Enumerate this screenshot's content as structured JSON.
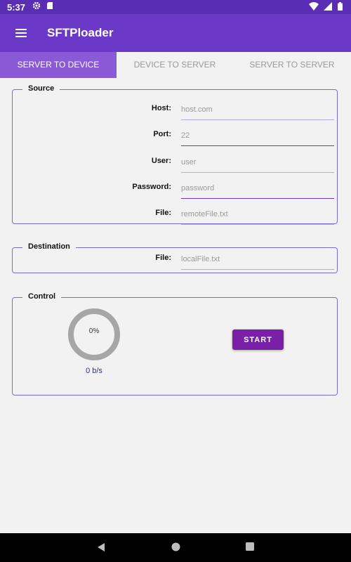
{
  "status_bar": {
    "time": "5:37",
    "left_icons": [
      "gear-icon",
      "sd-card-icon"
    ],
    "right_icons": [
      "wifi-icon",
      "signal-icon",
      "battery-icon"
    ]
  },
  "toolbar": {
    "title": "SFTPloader",
    "color": "#6a39c7"
  },
  "tabs": [
    {
      "label": "SERVER TO DEVICE",
      "active": true
    },
    {
      "label": "DEVICE TO SERVER",
      "active": false
    },
    {
      "label": "SERVER TO SERVER",
      "active": false
    }
  ],
  "source": {
    "title": "Source",
    "host": {
      "label": "Host:",
      "placeholder": "host.com"
    },
    "port": {
      "label": "Port:",
      "placeholder": "22"
    },
    "user": {
      "label": "User:",
      "placeholder": "user"
    },
    "password": {
      "label": "Password:",
      "placeholder": "password"
    },
    "file": {
      "label": "File:",
      "placeholder": "remoteFile.txt"
    }
  },
  "destination": {
    "title": "Destination",
    "file": {
      "label": "File:",
      "placeholder": "localFile.txt"
    }
  },
  "control": {
    "title": "Control",
    "progress": 0,
    "progress_text": "0%",
    "speed": "0 b/s",
    "start_label": "START",
    "button_color": "#7a1fa8"
  },
  "nav_bar": {
    "icons": [
      "back-icon",
      "home-icon",
      "recents-icon"
    ]
  }
}
